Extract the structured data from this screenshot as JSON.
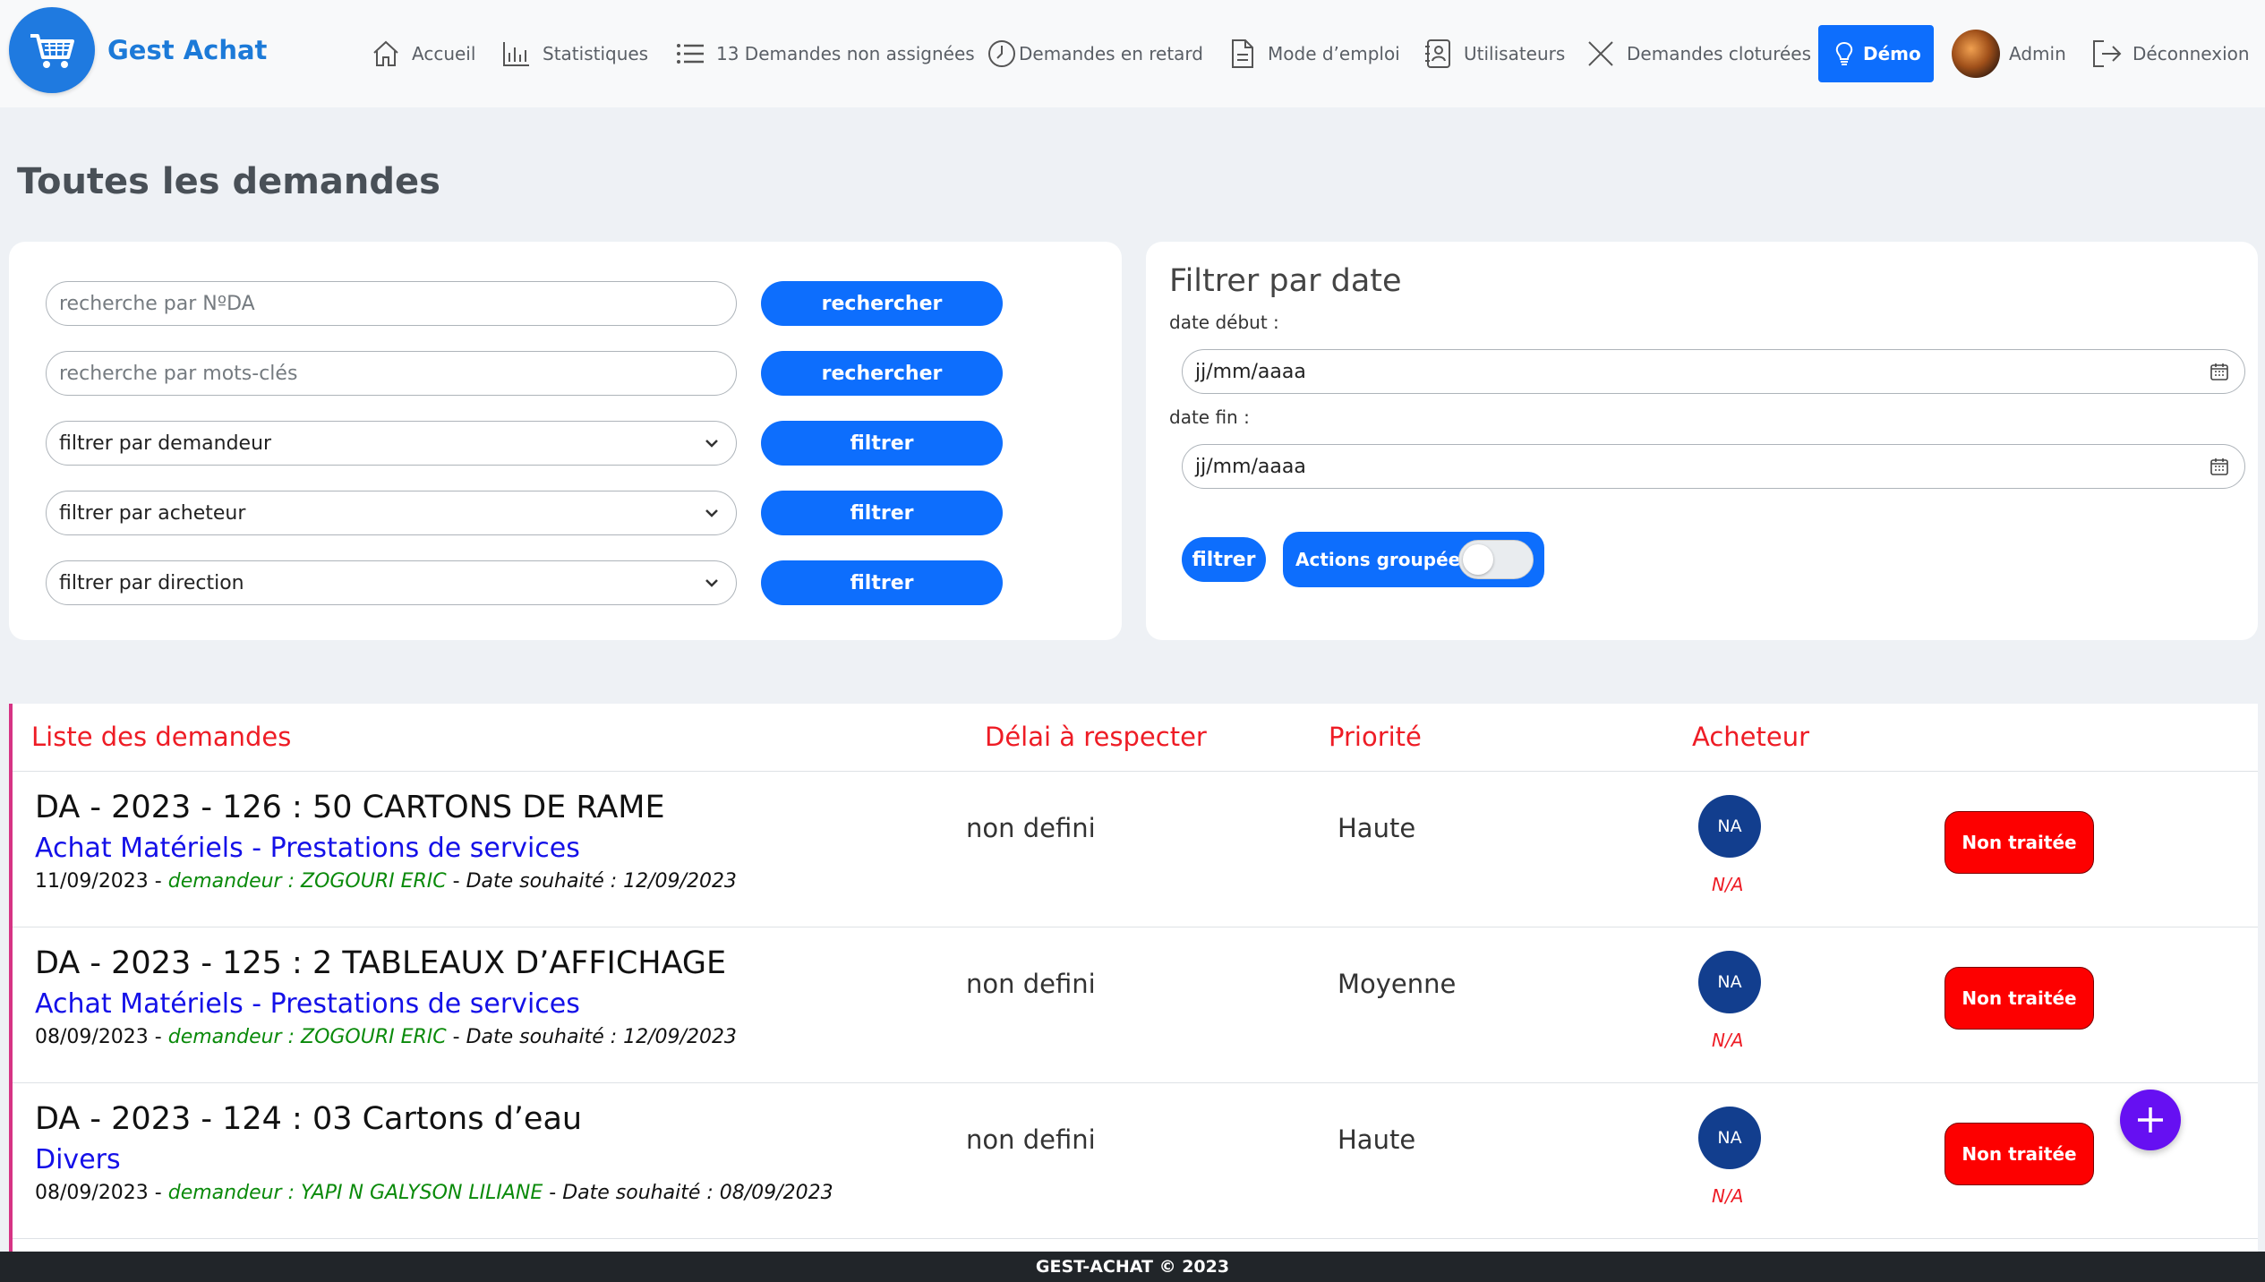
{
  "brand": {
    "name": "Gest Achat"
  },
  "nav": {
    "accueil": "Accueil",
    "statistiques": "Statistiques",
    "non_assignees": "13 Demandes non assignées",
    "en_retard": "Demandes en retard",
    "mode_emploi": "Mode d’emploi",
    "utilisateurs": "Utilisateurs",
    "cloturees": "Demandes cloturées",
    "demo": "Démo",
    "admin": "Admin",
    "deconnexion": "Déconnexion"
  },
  "page": {
    "title": "Toutes les demandes"
  },
  "search": {
    "nda_placeholder": "recherche par NºDA",
    "keywords_placeholder": "recherche par mots-clés",
    "search_label": "rechercher",
    "demandeur_select": "filtrer par demandeur",
    "acheteur_select": "filtrer par acheteur",
    "direction_select": "filtrer par direction",
    "filter_label": "filtrer"
  },
  "date_filter": {
    "title": "Filtrer par date",
    "start_label": "date début :",
    "end_label": "date fin :",
    "date_placeholder": "jj/mm/aaaa",
    "filter_label": "filtrer",
    "group_actions_label": "Actions groupées",
    "group_actions_enabled": false
  },
  "list": {
    "headers": {
      "liste": "Liste des demandes",
      "delai": "Délai à respecter",
      "priorite": "Priorité",
      "acheteur": "Acheteur"
    },
    "rows": [
      {
        "title": "DA - 2023 - 126 : 50 CARTONS DE RAME",
        "category": "Achat Matériels - Prestations de services",
        "date": "11/09/2023",
        "requester": "demandeur : ZOGOURI ERIC",
        "wished": "Date souhaité : 12/09/2023",
        "delay": "non defini",
        "priority": "Haute",
        "buyer_initials": "NA",
        "buyer_name": "N/A",
        "status": "Non traitée"
      },
      {
        "title": "DA - 2023 - 125 : 2 TABLEAUX D’AFFICHAGE",
        "category": "Achat Matériels - Prestations de services",
        "date": "08/09/2023",
        "requester": "demandeur : ZOGOURI ERIC",
        "wished": "Date souhaité : 12/09/2023",
        "delay": "non defini",
        "priority": "Moyenne",
        "buyer_initials": "NA",
        "buyer_name": "N/A",
        "status": "Non traitée"
      },
      {
        "title": "DA - 2023 - 124 : 03 Cartons d’eau",
        "category": "Divers",
        "date": "08/09/2023",
        "requester": "demandeur : YAPI N GALYSON LILIANE",
        "wished": "Date souhaité : 08/09/2023",
        "delay": "non defini",
        "priority": "Haute",
        "buyer_initials": "NA",
        "buyer_name": "N/A",
        "status": "Non traitée"
      }
    ]
  },
  "footer": {
    "text": "GEST-ACHAT © 2023"
  },
  "colors": {
    "primary": "#0d6efd",
    "brand": "#1c7ad8",
    "header_red": "#ee1c25",
    "category_blue": "#1410e8",
    "requester_green": "#0a8a0a",
    "status_red": "#fd0000",
    "fab_purple": "#6610f2"
  },
  "icons": [
    "cart-icon",
    "home-icon",
    "chart-icon",
    "list-icon",
    "clock-icon",
    "document-icon",
    "contact-icon",
    "close-icon",
    "lightbulb-icon",
    "logout-icon",
    "chevron-down-icon",
    "calendar-icon",
    "plus-icon"
  ]
}
